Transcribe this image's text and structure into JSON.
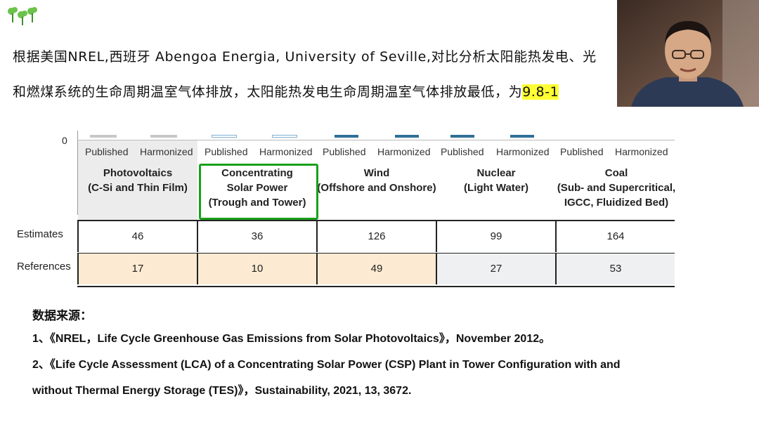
{
  "slide": {
    "line1": "根据美国NREL,西班牙 Abengoa Energia, University of Seville,对比分析太阳能热发电、光",
    "line2_before": "和燃煤系统的生命周期温室气体排放，太阳能热发电生命周期温室气体排放最低，为",
    "line2_highlight": "9.8-1"
  },
  "table": {
    "axis_zero": "0",
    "groups": [
      {
        "published": "Published",
        "harmonized": "Harmonized",
        "name": "Photovoltaics",
        "sub1": "(C-Si and Thin Film)",
        "sub2": "",
        "estimates": "46",
        "references": "17"
      },
      {
        "published": "Published",
        "harmonized": "Harmonized",
        "name": "Concentrating",
        "sub1": "Solar Power",
        "sub2": "(Trough and Tower)",
        "estimates": "36",
        "references": "10"
      },
      {
        "published": "Published",
        "harmonized": "Harmonized",
        "name": "Wind",
        "sub1": "(Offshore and Onshore)",
        "sub2": "",
        "estimates": "126",
        "references": "49"
      },
      {
        "published": "Published",
        "harmonized": "Harmonized",
        "name": "Nuclear",
        "sub1": "(Light Water)",
        "sub2": "",
        "estimates": "99",
        "references": "27"
      },
      {
        "published": "Published",
        "harmonized": "Harmonized",
        "name": "Coal",
        "sub1": "(Sub- and Supercritical,",
        "sub2": "IGCC, Fluidized Bed)",
        "estimates": "164",
        "references": "53"
      }
    ],
    "row_labels": {
      "estimates": "Estimates",
      "references": "References"
    }
  },
  "sources": {
    "title": "数据来源：",
    "item1": "1、《NREL，Life Cycle Greenhouse Gas Emissions from Solar Photovoltaics》，November 2012。",
    "item2_line1": "2、《Life Cycle Assessment (LCA) of a Concentrating Solar Power (CSP) Plant in Tower Configuration with and",
    "item2_line2": "without Thermal Energy Storage (TES)》，Sustainability, 2021, 13, 3672."
  },
  "colors": {
    "highlight": "#ffff33",
    "green_box": "#1aa01a",
    "logo_green": "#6cc24a",
    "ref_tan": "#fcebd2",
    "ref_gray": "#eef0f1",
    "pv_shade": "#ececec"
  },
  "icons": {
    "logo": "tree-logo-icon"
  }
}
